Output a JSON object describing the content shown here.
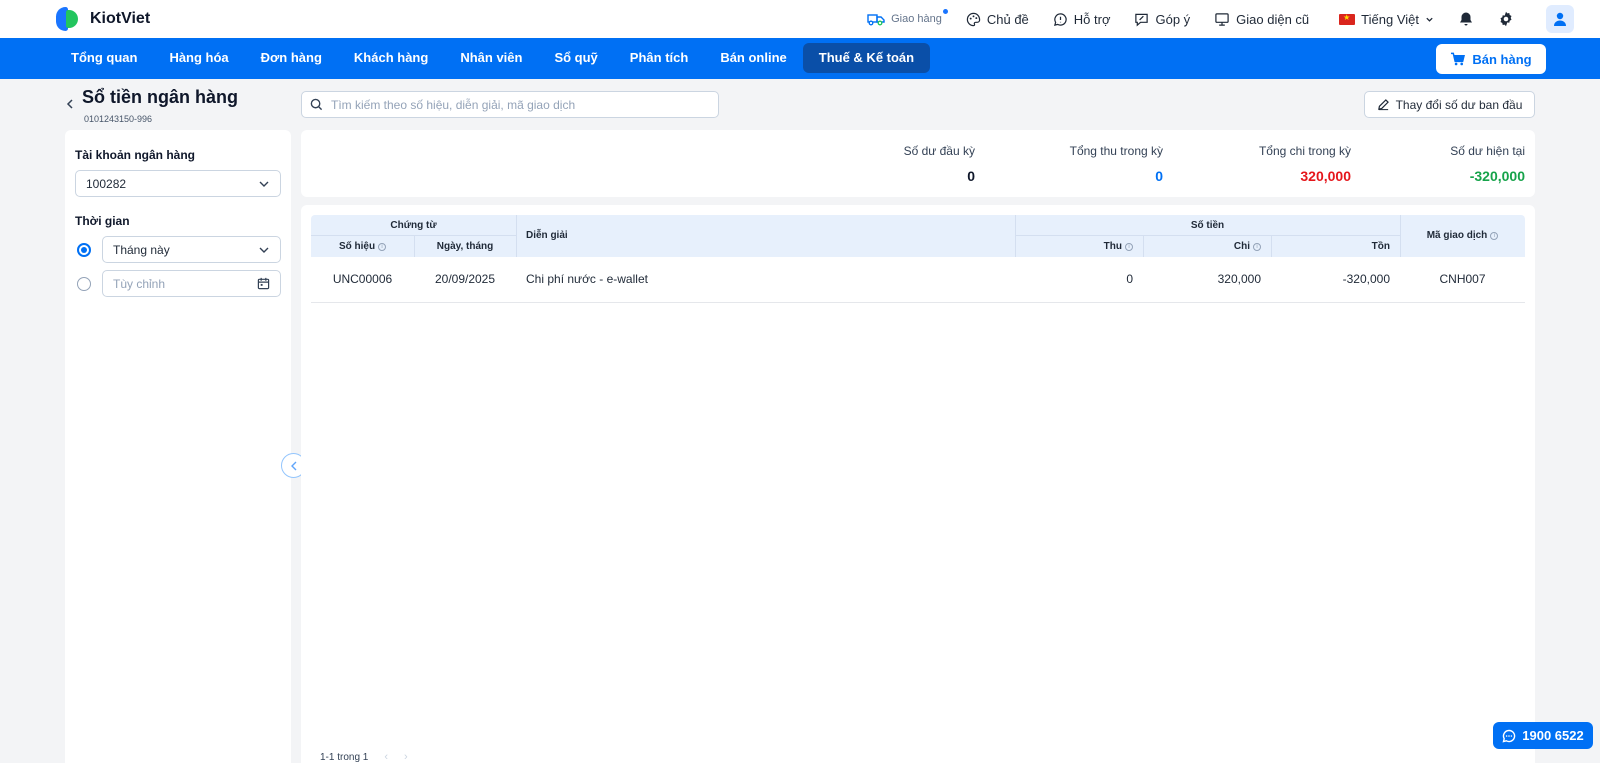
{
  "app": {
    "name": "KiotViet"
  },
  "topbar": {
    "delivery": "Giao hàng",
    "theme": "Chủ đề",
    "support": "Hỗ trợ",
    "feedback": "Góp ý",
    "old_ui": "Giao diện cũ",
    "language": "Tiếng Việt"
  },
  "nav": {
    "items": [
      "Tổng quan",
      "Hàng hóa",
      "Đơn hàng",
      "Khách hàng",
      "Nhân viên",
      "Sổ quỹ",
      "Phân tích",
      "Bán online",
      "Thuế & Kế toán"
    ],
    "active_index": 8,
    "sell_button": "Bán hàng"
  },
  "page": {
    "title": "Sổ tiền ngân hàng",
    "subtitle": "0101243150-996",
    "search_placeholder": "Tìm kiếm theo số hiệu, diễn giải, mã giao dịch",
    "change_button": "Thay đổi số dư ban đầu"
  },
  "sidebar": {
    "account_label": "Tài khoản ngân hàng",
    "account_value": "100282",
    "time_label": "Thời gian",
    "time_option": "Tháng này",
    "custom_placeholder": "Tùy chỉnh"
  },
  "summary": {
    "opening_label": "Số dư đầu kỳ",
    "opening_value": "0",
    "income_label": "Tổng thu trong kỳ",
    "income_value": "0",
    "expense_label": "Tổng chi trong kỳ",
    "expense_value": "320,000",
    "current_label": "Số dư hiện tại",
    "current_value": "-320,000"
  },
  "table": {
    "group_voucher": "Chứng từ",
    "group_amount": "Số tiền",
    "col_number": "Số hiệu",
    "col_date": "Ngày, tháng",
    "col_desc": "Diễn giải",
    "col_in": "Thu",
    "col_out": "Chi",
    "col_balance": "Tồn",
    "col_txn": "Mã giao dịch",
    "rows": [
      {
        "number": "UNC00006",
        "date": "20/09/2025",
        "desc": "Chi phí nước - e-wallet",
        "in": "0",
        "out": "320,000",
        "balance": "-320,000",
        "txn": "CNH007"
      }
    ],
    "pagination": "1-1 trong 1"
  },
  "hotline": "1900 6522",
  "colors": {
    "primary": "#0070f4",
    "income": "#0070f4",
    "expense": "#e5161b",
    "current": "#16a34a"
  }
}
